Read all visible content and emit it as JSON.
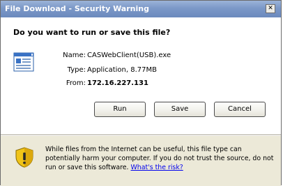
{
  "window": {
    "title": "File Download - Security Warning",
    "close_glyph": "✕"
  },
  "dialog": {
    "question": "Do you want to run or save this file?",
    "file_icon": "executable-file-icon",
    "fields": [
      {
        "label": "Name:",
        "value": "CASWebClient(USB).exe"
      },
      {
        "label": "Type:",
        "value": "Application, 8.77MB"
      },
      {
        "label": "From:",
        "value": "172.16.227.131"
      }
    ],
    "buttons": {
      "run": "Run",
      "save": "Save",
      "cancel": "Cancel"
    }
  },
  "warning": {
    "icon": "shield-warning-icon",
    "line1": "While files from the Internet can be useful, this file type can",
    "line2": "potentially harm your computer. If you do not trust the source, do not",
    "line3_prefix": "run or save this software.",
    "link_text": "What's the risk?"
  },
  "colors": {
    "titlebar": "#7b98c8",
    "panel_bg": "#ece9d8",
    "link": "#0000ee",
    "shield_yellow": "#f0c419"
  }
}
